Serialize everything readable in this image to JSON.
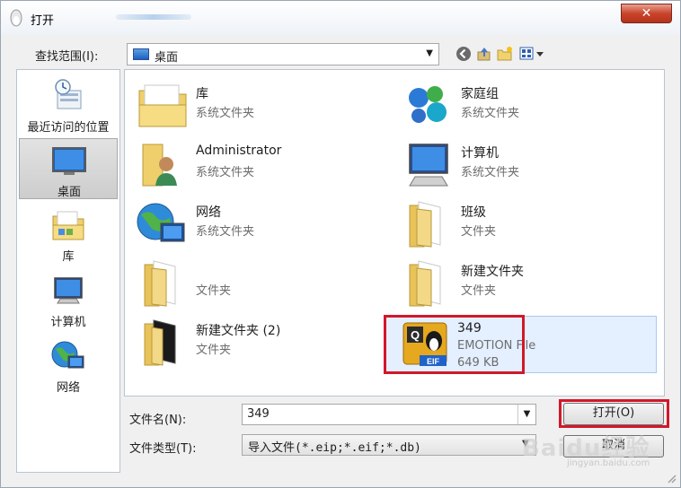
{
  "window": {
    "title": "打开"
  },
  "lookin": {
    "label": "查找范围(I):",
    "value": "桌面"
  },
  "toolbar": {
    "icons": [
      "back-icon",
      "up-folder-icon",
      "new-folder-icon",
      "view-menu-icon"
    ]
  },
  "sidebar": {
    "items": [
      {
        "label": "最近访问的位置",
        "icon": "recent-places-icon"
      },
      {
        "label": "桌面",
        "icon": "desktop-icon",
        "selected": true
      },
      {
        "label": "库",
        "icon": "library-icon"
      },
      {
        "label": "计算机",
        "icon": "computer-icon"
      },
      {
        "label": "网络",
        "icon": "network-icon"
      }
    ]
  },
  "files": [
    {
      "name": "库",
      "type": "系统文件夹",
      "icon": "library-folder-icon"
    },
    {
      "name": "家庭组",
      "type": "系统文件夹",
      "icon": "homegroup-icon"
    },
    {
      "name": "Administrator",
      "type": "系统文件夹",
      "icon": "user-folder-icon"
    },
    {
      "name": "计算机",
      "type": "系统文件夹",
      "icon": "computer-icon"
    },
    {
      "name": "网络",
      "type": "系统文件夹",
      "icon": "network-icon"
    },
    {
      "name": "班级",
      "type": "文件夹",
      "icon": "folder-icon"
    },
    {
      "name": "",
      "type": "文件夹",
      "icon": "folder-icon"
    },
    {
      "name": "新建文件夹",
      "type": "文件夹",
      "icon": "folder-icon"
    },
    {
      "name": "新建文件夹 (2)",
      "type": "文件夹",
      "icon": "folder-icon"
    },
    {
      "name": "349",
      "type": "EMOTION File",
      "size": "649 KB",
      "icon": "eif-file-icon",
      "selected": true
    }
  ],
  "filename": {
    "label": "文件名(N):",
    "value": "349"
  },
  "filetype": {
    "label": "文件类型(T):",
    "value": "导入文件(*.eip;*.eif;*.db)"
  },
  "buttons": {
    "open": "打开(O)",
    "cancel": "取消"
  },
  "watermark": {
    "text": "Baidu经验",
    "sub": "jingyan.baidu.com"
  },
  "colors": {
    "highlight_box": "#d3172a",
    "selection": "#e4efff"
  }
}
